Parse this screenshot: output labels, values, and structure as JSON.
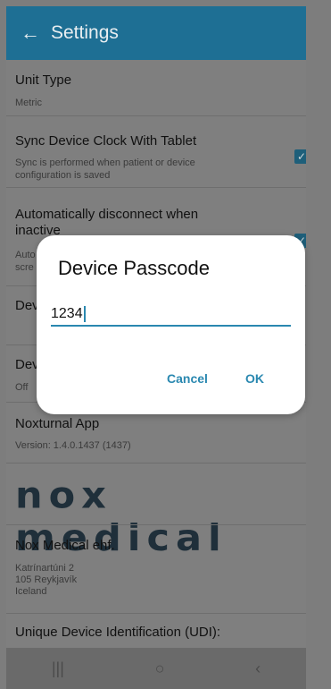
{
  "appbar": {
    "back_icon": "arrow-left-icon",
    "title": "Settings"
  },
  "settings": {
    "unit_type": {
      "title": "Unit Type",
      "value": "Metric"
    },
    "sync_clock": {
      "title": "Sync Device Clock With Tablet",
      "subtitle_line1": "Sync is performed when patient or device",
      "subtitle_line2": "configuration is saved",
      "checked": true
    },
    "auto_disconnect": {
      "title_line1": "Automatically disconnect when",
      "title_line2": "inactive",
      "subtitle_line1": "Auto",
      "subtitle_line2": "scre",
      "checked": true
    },
    "device_row1": {
      "title": "Dev"
    },
    "device_row2": {
      "title": "Dev",
      "value": "Off"
    },
    "app": {
      "title": "Noxturnal App",
      "version": "Version: 1.4.0.1437 (1437)"
    },
    "logo_text": "nox medical",
    "company": {
      "title": "Nox Medical ehf.",
      "address_line1": "Katrínartúni 2",
      "address_line2": "105 Reykjavík",
      "address_line3": "Iceland"
    },
    "udi": {
      "title": "Unique Device Identification (UDI):"
    }
  },
  "dialog": {
    "title": "Device Passcode",
    "input_value": "1234",
    "cancel_label": "Cancel",
    "ok_label": "OK"
  },
  "navbar": {
    "recents": "|||",
    "home": "○",
    "back": "‹"
  }
}
